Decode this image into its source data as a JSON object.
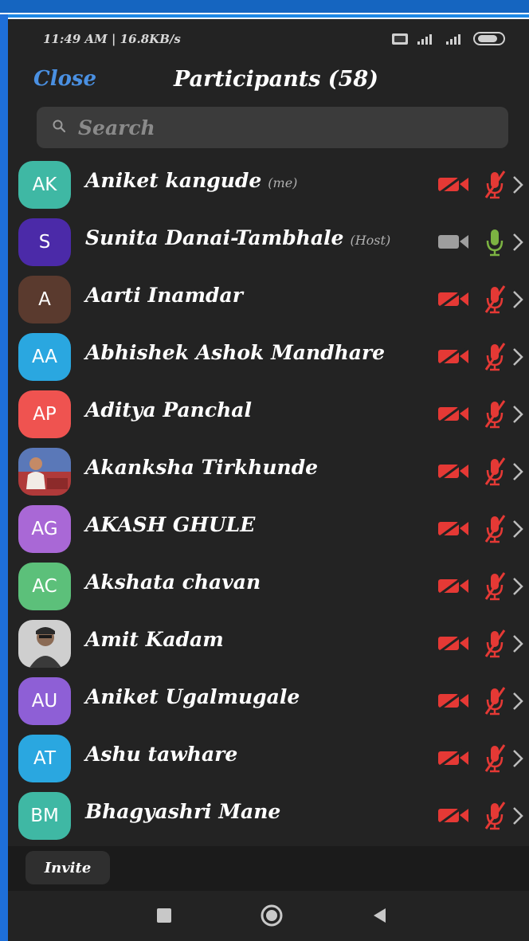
{
  "status_bar": {
    "time_speed": "11:49 AM | 16.8KB/s",
    "battery": "81"
  },
  "header": {
    "close_label": "Close",
    "title": "Participants (58)"
  },
  "search": {
    "placeholder": "Search"
  },
  "participants": [
    {
      "initials": "AK",
      "name": "Aniket kangude",
      "tag": "(me)",
      "avatar_color": "#3fb8a4",
      "video": "off",
      "mic": "muted"
    },
    {
      "initials": "S",
      "name": "Sunita Danai-Tambhale",
      "tag": "(Host)",
      "avatar_color": "#4b2aa8",
      "video": "on",
      "mic": "active"
    },
    {
      "initials": "A",
      "name": "Aarti Inamdar",
      "tag": "",
      "avatar_color": "#5a3a2e",
      "video": "off",
      "mic": "muted"
    },
    {
      "initials": "AA",
      "name": "Abhishek Ashok Mandhare",
      "tag": "",
      "avatar_color": "#2aa7e0",
      "video": "off",
      "mic": "muted"
    },
    {
      "initials": "AP",
      "name": "Aditya Panchal",
      "tag": "",
      "avatar_color": "#ef5350",
      "video": "off",
      "mic": "muted"
    },
    {
      "initials": "",
      "name": "Akanksha Tirkhunde",
      "tag": "",
      "avatar_color": "#3d4f7a",
      "video": "off",
      "mic": "muted"
    },
    {
      "initials": "AG",
      "name": "AKASH GHULE",
      "tag": "",
      "avatar_color": "#a968d6",
      "video": "off",
      "mic": "muted"
    },
    {
      "initials": "AC",
      "name": "Akshata chavan",
      "tag": "",
      "avatar_color": "#5cc07a",
      "video": "off",
      "mic": "muted"
    },
    {
      "initials": "",
      "name": "Amit Kadam",
      "tag": "",
      "avatar_color": "#8a8a8a",
      "video": "off",
      "mic": "muted"
    },
    {
      "initials": "AU",
      "name": "Aniket Ugalmugale",
      "tag": "",
      "avatar_color": "#8e5fd6",
      "video": "off",
      "mic": "muted"
    },
    {
      "initials": "AT",
      "name": "Ashu tawhare",
      "tag": "",
      "avatar_color": "#2aa7e0",
      "video": "off",
      "mic": "muted"
    },
    {
      "initials": "BM",
      "name": "Bhagyashri Mane",
      "tag": "",
      "avatar_color": "#3fb8a4",
      "video": "off",
      "mic": "muted"
    }
  ],
  "footer": {
    "invite_label": "Invite"
  },
  "colors": {
    "accent": "#4a90e2",
    "muted_red": "#e53935",
    "mic_green": "#7cb342",
    "video_on_gray": "#9e9e9e"
  }
}
